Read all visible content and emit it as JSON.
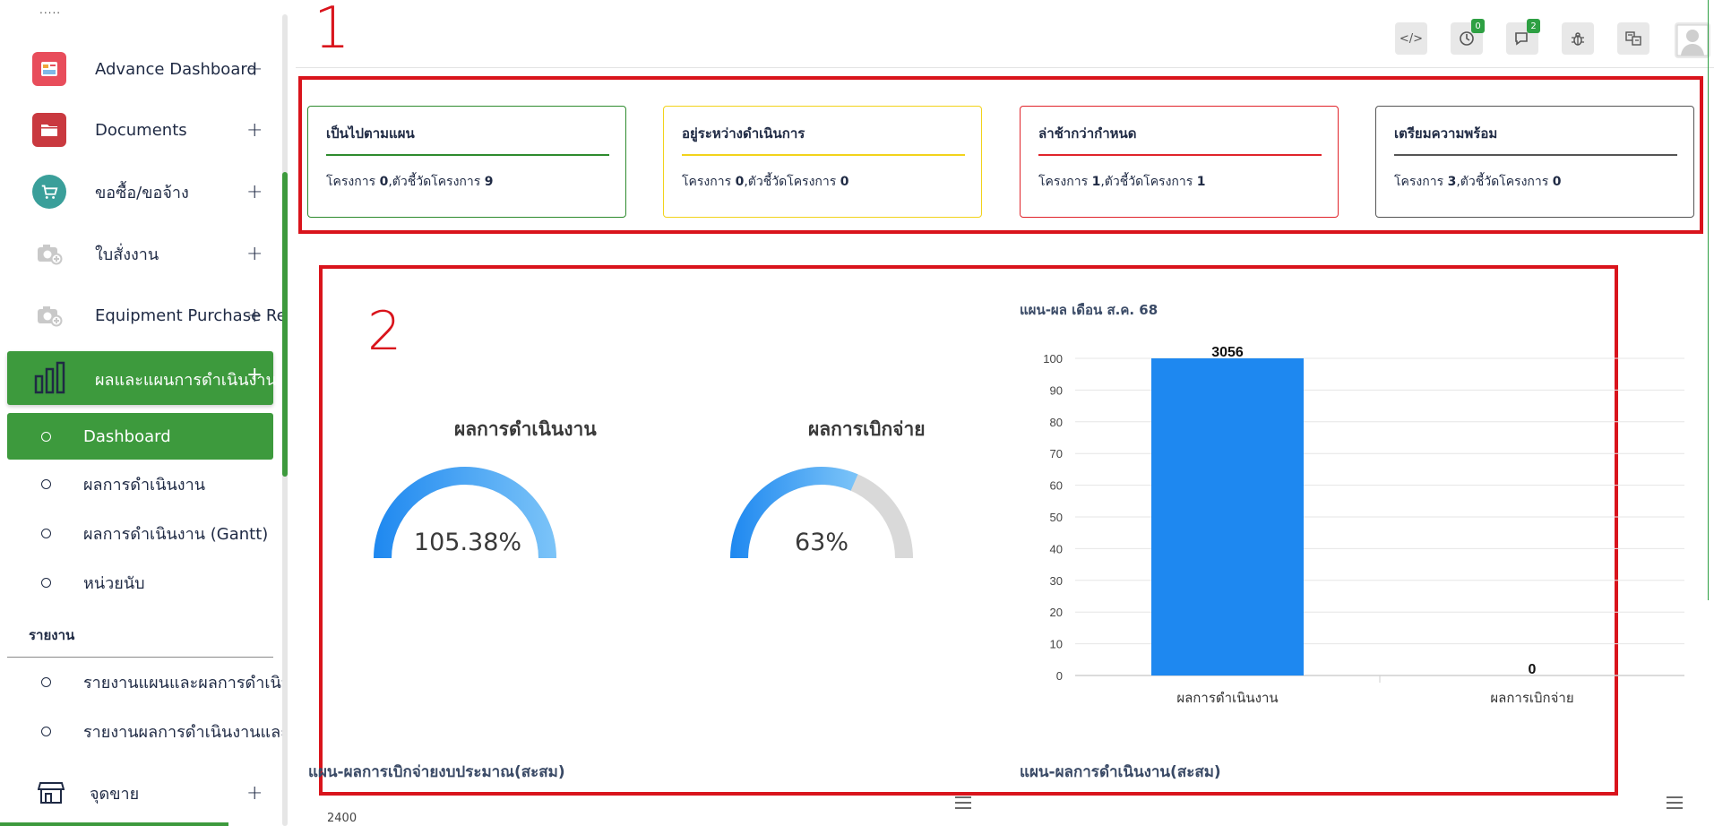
{
  "sidebar": {
    "dots": ".....",
    "items": [
      {
        "label": "Advance Dashboard",
        "icon": "dashboard-icon"
      },
      {
        "label": "Documents",
        "icon": "folder-icon"
      },
      {
        "label": "ขอซื้อ/ขอจ้าง",
        "icon": "cart-icon"
      },
      {
        "label": "ใบสั่งงาน",
        "icon": "camera-icon"
      },
      {
        "label": "Equipment Purchase Req",
        "icon": "camera-icon"
      }
    ],
    "active": {
      "label": "ผลและแผนการดำเนินงาน",
      "icon": "bar-chart-icon"
    },
    "subitems": [
      {
        "label": "Dashboard"
      },
      {
        "label": "ผลการดำเนินงาน"
      },
      {
        "label": "ผลการดำเนินงาน (Gantt)"
      },
      {
        "label": "หน่วยนับ"
      }
    ],
    "section_heading": "รายงาน",
    "report_items": [
      {
        "label": "รายงานแผนและผลการดำเนิน"
      },
      {
        "label": "รายงานผลการดำเนินงานและก"
      }
    ],
    "bottom_item": {
      "label": "จุดขาย",
      "icon": "store-icon"
    },
    "plus": "+"
  },
  "topbar": {
    "buttons": [
      {
        "icon": "code-icon",
        "glyph": "</>"
      },
      {
        "icon": "timer-icon",
        "badge": "0"
      },
      {
        "icon": "chat-icon",
        "badge": "2"
      },
      {
        "icon": "bug-icon"
      },
      {
        "icon": "translate-icon"
      }
    ],
    "avatar_icon": "user-avatar-icon"
  },
  "annotations": {
    "box1_label": "1",
    "box2_label": "2"
  },
  "cards": [
    {
      "title": "เป็นไปตามแผน",
      "color": "#2e8b2e",
      "prefix": "โครงการ ",
      "projects": "0",
      "mid": ",ตัวชี้วัดโครงการ ",
      "indicators": "9"
    },
    {
      "title": "อยู่ระหว่างดำเนินการ",
      "color": "#f2d31b",
      "prefix": "โครงการ ",
      "projects": "0",
      "mid": ",ตัวชี้วัดโครงการ ",
      "indicators": "0"
    },
    {
      "title": "ล่าช้ากว่ากำหนด",
      "color": "#e0242b",
      "prefix": "โครงการ ",
      "projects": "1",
      "mid": ",ตัวชี้วัดโครงการ ",
      "indicators": "1"
    },
    {
      "title": "เตรียมความพร้อม",
      "color": "#555555",
      "prefix": "โครงการ ",
      "projects": "3",
      "mid": ",ตัวชี้วัดโครงการ ",
      "indicators": "0"
    }
  ],
  "gauges": [
    {
      "title": "ผลการดำเนินงาน",
      "value_label": "105.38%",
      "percent": 105.38
    },
    {
      "title": "ผลการเบิกจ่าย",
      "value_label": "63%",
      "percent": 63
    }
  ],
  "chart_data": {
    "type": "bar",
    "title": "แผน-ผล เดือน ส.ค. 68",
    "categories": [
      "ผลการดำเนินงาน",
      "ผลการเบิกจ่าย"
    ],
    "values": [
      3056,
      0
    ],
    "data_labels": [
      "3056",
      "0"
    ],
    "ylim": [
      0,
      100
    ],
    "yticks": [
      "0",
      "10",
      "20",
      "30",
      "40",
      "50",
      "60",
      "70",
      "80",
      "90",
      "100"
    ],
    "bar_color": "#1e88f0",
    "grid": true
  },
  "lower_charts": {
    "left_title": "แผน-ผลการเบิกจ่ายงบประมาณ(สะสม)",
    "left_ytick": "2400",
    "right_title": "แผน-ผลการดำเนินงาน(สะสม)"
  }
}
